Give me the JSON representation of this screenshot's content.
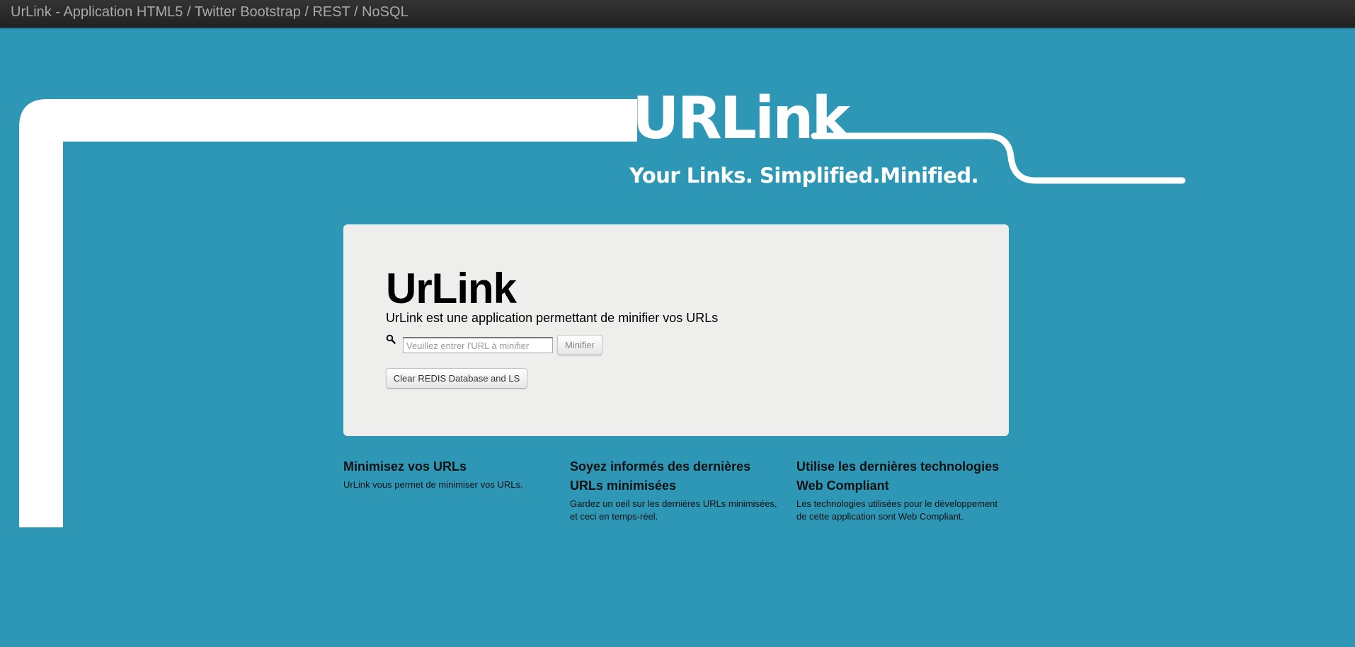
{
  "navbar": {
    "brand": "UrLink - Application HTML5 / Twitter Bootstrap / REST / NoSQL"
  },
  "logo": {
    "title": "URLink",
    "tagline": "Your Links. Simplified.Minified."
  },
  "hero": {
    "title": "UrLink",
    "subtitle": "UrLink est une application permettant de minifier vos URLs",
    "url_input": {
      "value": "",
      "placeholder": "Veuillez entrer l'URL à minifier"
    },
    "minify_label": "Minifier",
    "clear_label": "Clear REDIS Database and LS"
  },
  "features": [
    {
      "title": "Minimisez vos URLs",
      "text": "UrLink vous permet de minimiser vos URLs."
    },
    {
      "title": "Soyez informés des dernières URLs minimisées",
      "text": "Gardez un oeil sur les dernières URLs minimisées, et ceci en temps-réel."
    },
    {
      "title": "Utilise les dernières technologies Web Compliant",
      "text": "Les technologies utilisées pour le développement de cette application sont Web Compliant."
    }
  ],
  "colors": {
    "background": "#2e97b6",
    "navbar": "#222222",
    "hero_background": "#eeeeec",
    "logo": "#ffffff"
  },
  "icons": {
    "search": "search-icon"
  }
}
